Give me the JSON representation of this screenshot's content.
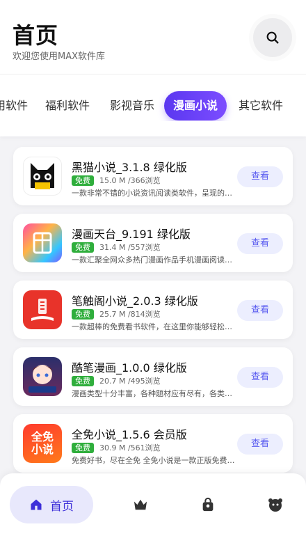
{
  "header": {
    "title": "首页",
    "subtitle": "欢迎您使用MAX软件库"
  },
  "tabs": [
    {
      "label": "用软件",
      "active": false
    },
    {
      "label": "福利软件",
      "active": false
    },
    {
      "label": "影视音乐",
      "active": false
    },
    {
      "label": "漫画小说",
      "active": true
    },
    {
      "label": "其它软件",
      "active": false
    }
  ],
  "apps": [
    {
      "name": "黑猫小说_3.1.8 绿化版",
      "badge": "免费",
      "stats": "15.0 M /366浏览",
      "desc": "一款非常不错的小说资讯阅读类软件，呈现的…",
      "button": "查看",
      "icon": "black-cat-icon"
    },
    {
      "name": "漫画天台_9.191 绿化版",
      "badge": "免费",
      "stats": "31.4 M /557浏览",
      "desc": "一款汇聚全网众多热门漫画作品手机漫画阅读…",
      "button": "查看",
      "icon": "manga-rooftop-icon"
    },
    {
      "name": "笔触阁小说_2.0.3 绿化版",
      "badge": "免费",
      "stats": "25.7 M /814浏览",
      "desc": "一款超棒的免费看书软件，在这里你能够轻松…",
      "button": "查看",
      "icon": "red-book-icon"
    },
    {
      "name": "酷笔漫画_1.0.0 绿化版",
      "badge": "免费",
      "stats": "20.7 M /495浏览",
      "desc": "漫画类型十分丰富，各种题材应有尽有，各类…",
      "button": "查看",
      "icon": "anime-girl-icon"
    },
    {
      "name": "全免小说_1.5.6 会员版",
      "badge": "免费",
      "stats": "30.9 M /561浏览",
      "desc": "免费好书，尽在全免 全免小说是一款正版免费…",
      "button": "查看",
      "icon": "quanmian-icon",
      "icon_text_1": "全免",
      "icon_text_2": "小说"
    }
  ],
  "bottom_nav": {
    "home_label": "首页"
  },
  "colors": {
    "accent": "#5a37f0",
    "badge": "#2fae3c",
    "view_button_bg": "#eceefe"
  }
}
